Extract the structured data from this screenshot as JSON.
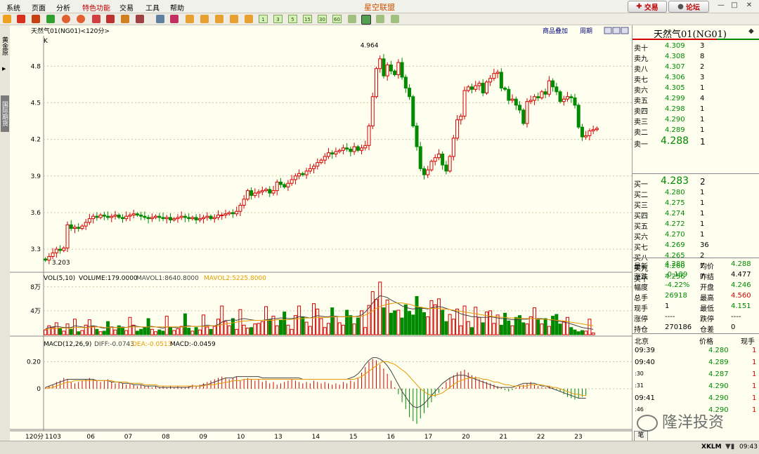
{
  "menu": {
    "items": [
      "系统",
      "页面",
      "分析",
      "特色功能",
      "交易",
      "工具",
      "帮助"
    ],
    "highlight_index": 3
  },
  "app_title": "星空联盟",
  "top_buttons": {
    "trade": "交易",
    "forum": "论坛"
  },
  "toolbar": {
    "period_buttons": [
      "1",
      "3",
      "5",
      "15",
      "30",
      "60"
    ]
  },
  "side_tabs": [
    "黄金原",
    "国际期货"
  ],
  "chart": {
    "header_title": "天然气01(NG01)<120分>",
    "panel_links": [
      "商品叠加",
      "周期"
    ],
    "price_label": "K",
    "high_label": "4.964",
    "low_label": "3.203",
    "price_axis": [
      "4.8",
      "4.5",
      "4.2",
      "3.9",
      "3.6",
      "3.3"
    ],
    "vol_header": {
      "title": "VOL(5,10)",
      "volume": "VOLUME:179.0000",
      "mavol1": "MAVOL1:8640.8000",
      "mavol2": "MAVOL2:5225.8000"
    },
    "vol_axis": [
      "8万",
      "4万"
    ],
    "macd_header": {
      "title": "MACD(12,26,9)",
      "diff": "DIFF:-0.0743",
      "dea": "DEA:-0.0513",
      "macd": "MACD:-0.0459"
    },
    "macd_axis": [
      "0.20",
      "0"
    ],
    "period_label": "120分",
    "x_axis": [
      "1103",
      "06",
      "07",
      "08",
      "09",
      "10",
      "13",
      "14",
      "15",
      "16",
      "17",
      "20",
      "21",
      "22",
      "23"
    ],
    "colors": {
      "up": "#d40000",
      "down": "#008a00",
      "ma1": "#444444",
      "ma2": "#e69a00"
    }
  },
  "chart_data": {
    "type": "candlestick",
    "interval": "120分",
    "ylim": [
      3.18,
      5.02
    ],
    "closes": [
      3.21,
      3.24,
      3.27,
      3.3,
      3.29,
      3.31,
      3.5,
      3.47,
      3.48,
      3.47,
      3.49,
      3.52,
      3.55,
      3.57,
      3.56,
      3.58,
      3.57,
      3.56,
      3.57,
      3.58,
      3.56,
      3.55,
      3.57,
      3.58,
      3.59,
      3.58,
      3.57,
      3.56,
      3.55,
      3.56,
      3.57,
      3.56,
      3.55,
      3.56,
      3.54,
      3.55,
      3.56,
      3.57,
      3.56,
      3.55,
      3.56,
      3.54,
      3.55,
      3.56,
      3.57,
      3.55,
      3.56,
      3.58,
      3.58,
      3.59,
      3.6,
      3.59,
      3.61,
      3.66,
      3.71,
      3.78,
      3.74,
      3.76,
      3.77,
      3.78,
      3.79,
      3.76,
      3.78,
      3.85,
      3.83,
      3.81,
      3.84,
      3.87,
      3.9,
      3.92,
      3.91,
      3.94,
      3.96,
      3.98,
      4.01,
      4.03,
      4.06,
      4.09,
      4.08,
      4.1,
      4.11,
      4.13,
      4.12,
      4.1,
      4.14,
      4.11,
      4.13,
      4.15,
      4.31,
      4.55,
      4.78,
      4.86,
      4.72,
      4.81,
      4.76,
      4.73,
      4.83,
      4.71,
      4.62,
      4.55,
      4.31,
      4.14,
      3.96,
      3.91,
      3.95,
      4.02,
      4.05,
      4.08,
      3.99,
      3.94,
      4.06,
      4.21,
      4.36,
      4.39,
      4.6,
      4.63,
      4.61,
      4.64,
      4.66,
      4.58,
      4.67,
      4.7,
      4.74,
      4.75,
      4.62,
      4.61,
      4.52,
      4.53,
      4.48,
      4.44,
      4.33,
      4.51,
      4.52,
      4.55,
      4.54,
      4.59,
      4.57,
      4.68,
      4.63,
      4.59,
      4.51,
      4.53,
      4.55,
      4.54,
      4.48,
      4.3,
      4.22,
      4.23,
      4.27,
      4.28,
      4.29
    ],
    "volumes": [
      8000,
      15000,
      12000,
      20000,
      10000,
      6000,
      18000,
      9000,
      26000,
      5000,
      7000,
      16000,
      25000,
      14000,
      9000,
      5000,
      6000,
      22000,
      13000,
      8000,
      15000,
      11000,
      7000,
      29000,
      16000,
      6000,
      9000,
      12000,
      27000,
      9000,
      5000,
      8000,
      6000,
      31000,
      12000,
      7000,
      10000,
      14000,
      35000,
      11000,
      6000,
      12000,
      8000,
      33000,
      13000,
      9000,
      14000,
      26000,
      48000,
      22000,
      15000,
      27000,
      9000,
      42000,
      16000,
      11000,
      12000,
      18000,
      19000,
      22000,
      47000,
      25000,
      31000,
      15000,
      24000,
      38000,
      16000,
      9000,
      32000,
      48000,
      30000,
      21000,
      14000,
      52000,
      43000,
      27000,
      12000,
      19000,
      45000,
      30000,
      20000,
      16000,
      41000,
      32000,
      18000,
      28000,
      40000,
      12000,
      49000,
      72000,
      59000,
      88000,
      45000,
      58000,
      36000,
      40000,
      41000,
      28000,
      50000,
      39000,
      33000,
      64000,
      46000,
      37000,
      30000,
      57000,
      50000,
      60000,
      41000,
      22000,
      34000,
      26000,
      43000,
      15000,
      48000,
      22000,
      12000,
      46000,
      29000,
      20000,
      38000,
      40000,
      19000,
      33000,
      16000,
      36000,
      23000,
      15000,
      29000,
      32000,
      20000,
      18000,
      30000,
      45000,
      25000,
      18000,
      27000,
      14000,
      31000,
      34000,
      18000,
      22000,
      29000,
      12000,
      8000,
      5000,
      7000,
      6000,
      26000,
      3000
    ],
    "macd": [
      0.01,
      0.02,
      0.03,
      0.05,
      0.06,
      0.08,
      0.07,
      0.05,
      0.04,
      0.05,
      0.06,
      0.07,
      0.08,
      0.07,
      0.06,
      0.05,
      0.06,
      0.07,
      0.05,
      0.04,
      0.05,
      0.04,
      0.03,
      0.04,
      0.03,
      0.02,
      0.03,
      0.02,
      0.02,
      0.01,
      0.02,
      0.01,
      0.02,
      0.01,
      0.02,
      0.01,
      0.02,
      0.01,
      0.01,
      0.02,
      0.03,
      0.02,
      0.03,
      0.04,
      0.05,
      0.06,
      0.07,
      0.08,
      0.09,
      0.08,
      0.07,
      0.08,
      0.09,
      0.06,
      0.07,
      0.08,
      0.07,
      0.06,
      0.07,
      0.05,
      0.06,
      0.04,
      0.05,
      0.03,
      0.04,
      0.05,
      0.06,
      0.07,
      0.06,
      0.05,
      0.04,
      0.05,
      0.04,
      0.06,
      0.05,
      0.04,
      0.05,
      0.04,
      0.03,
      0.04,
      0.03,
      0.05,
      0.04,
      0.06,
      0.05,
      0.08,
      0.12,
      0.16,
      0.2,
      0.22,
      0.21,
      0.18,
      0.15,
      0.11,
      0.06,
      0.01,
      -0.04,
      -0.1,
      -0.15,
      -0.21,
      -0.24,
      -0.26,
      -0.22,
      -0.18,
      -0.14,
      -0.1,
      -0.06,
      -0.03,
      0.01,
      0.05,
      0.08,
      0.1,
      0.12,
      0.13,
      0.14,
      0.12,
      0.1,
      0.09,
      0.07,
      0.06,
      0.05,
      0.04,
      0.03,
      0.02,
      0.01,
      -0.01,
      -0.02,
      -0.01,
      0.01,
      0.02,
      0.03,
      0.04,
      0.05,
      0.03,
      0.02,
      0.01,
      0.01,
      0.02,
      0.01,
      -0.01,
      -0.02,
      -0.04,
      -0.06,
      -0.07,
      -0.08,
      -0.07,
      -0.06,
      -0.05
    ],
    "diff": [
      0.01,
      0.02,
      0.03,
      0.04,
      0.05,
      0.06,
      0.07,
      0.07,
      0.07,
      0.07,
      0.07,
      0.07,
      0.07,
      0.07,
      0.06,
      0.06,
      0.06,
      0.06,
      0.05,
      0.05,
      0.05,
      0.04,
      0.04,
      0.04,
      0.03,
      0.03,
      0.03,
      0.02,
      0.02,
      0.02,
      0.02,
      0.01,
      0.01,
      0.01,
      0.01,
      0.01,
      0.01,
      0.01,
      0.01,
      0.01,
      0.02,
      0.02,
      0.02,
      0.03,
      0.03,
      0.04,
      0.05,
      0.06,
      0.07,
      0.08,
      0.08,
      0.08,
      0.09,
      0.09,
      0.09,
      0.09,
      0.09,
      0.09,
      0.09,
      0.08,
      0.08,
      0.08,
      0.08,
      0.08,
      0.08,
      0.08,
      0.08,
      0.08,
      0.08,
      0.08,
      0.07,
      0.07,
      0.07,
      0.07,
      0.07,
      0.07,
      0.07,
      0.07,
      0.07,
      0.07,
      0.07,
      0.07,
      0.07,
      0.08,
      0.09,
      0.11,
      0.14,
      0.18,
      0.21,
      0.23,
      0.23,
      0.22,
      0.2,
      0.17,
      0.13,
      0.08,
      0.03,
      -0.02,
      -0.06,
      -0.1,
      -0.13,
      -0.14,
      -0.13,
      -0.11,
      -0.08,
      -0.05,
      -0.02,
      0.01,
      0.04,
      0.06,
      0.08,
      0.09,
      0.1,
      0.1,
      0.1,
      0.09,
      0.08,
      0.07,
      0.06,
      0.05,
      0.04,
      0.03,
      0.02,
      0.01,
      0.01,
      0.01,
      0.01,
      0.01,
      0.02,
      0.03,
      0.04,
      0.04,
      0.04,
      0.04,
      0.03,
      0.02,
      0.02,
      0.01,
      0,
      -0.01,
      -0.02,
      -0.03,
      -0.04,
      -0.05,
      -0.06,
      -0.07,
      -0.07,
      -0.07
    ],
    "dea": [
      0,
      0.01,
      0.01,
      0.02,
      0.03,
      0.04,
      0.05,
      0.05,
      0.06,
      0.06,
      0.06,
      0.06,
      0.06,
      0.06,
      0.06,
      0.06,
      0.06,
      0.06,
      0.06,
      0.05,
      0.05,
      0.05,
      0.05,
      0.04,
      0.04,
      0.04,
      0.04,
      0.03,
      0.03,
      0.03,
      0.03,
      0.02,
      0.02,
      0.02,
      0.02,
      0.02,
      0.02,
      0.02,
      0.02,
      0.02,
      0.02,
      0.02,
      0.02,
      0.02,
      0.03,
      0.03,
      0.03,
      0.04,
      0.04,
      0.05,
      0.05,
      0.06,
      0.06,
      0.06,
      0.07,
      0.07,
      0.07,
      0.07,
      0.07,
      0.07,
      0.07,
      0.07,
      0.07,
      0.07,
      0.07,
      0.07,
      0.07,
      0.07,
      0.07,
      0.07,
      0.07,
      0.07,
      0.07,
      0.07,
      0.07,
      0.07,
      0.07,
      0.07,
      0.07,
      0.07,
      0.07,
      0.07,
      0.07,
      0.07,
      0.07,
      0.08,
      0.09,
      0.11,
      0.13,
      0.15,
      0.17,
      0.19,
      0.2,
      0.2,
      0.19,
      0.18,
      0.16,
      0.14,
      0.12,
      0.09,
      0.06,
      0.03,
      0,
      -0.02,
      -0.04,
      -0.05,
      -0.05,
      -0.04,
      -0.03,
      -0.01,
      0.01,
      0.03,
      0.05,
      0.06,
      0.07,
      0.08,
      0.08,
      0.08,
      0.08,
      0.07,
      0.07,
      0.06,
      0.05,
      0.05,
      0.04,
      0.03,
      0.03,
      0.02,
      0.02,
      0.02,
      0.02,
      0.02,
      0.03,
      0.03,
      0.03,
      0.03,
      0.02,
      0.02,
      0.01,
      0.01,
      0,
      -0.01,
      -0.02,
      -0.03,
      -0.04,
      -0.04,
      -0.05,
      -0.05
    ],
    "mavol1": [
      10000,
      12000,
      13000,
      14000,
      13000,
      12000,
      12000,
      12000,
      15000,
      14000,
      13000,
      12000,
      14000,
      15000,
      14000,
      12000,
      11000,
      12000,
      13000,
      12000,
      12000,
      13000,
      12000,
      14000,
      15000,
      14000,
      13000,
      12000,
      14000,
      14000,
      13000,
      12000,
      11000,
      13000,
      13000,
      12000,
      12000,
      13000,
      15000,
      15000,
      14000,
      14000,
      14000,
      15000,
      16000,
      15000,
      15000,
      17000,
      21000,
      24000,
      24000,
      25000,
      24000,
      26000,
      27000,
      26000,
      25000,
      24000,
      24000,
      24000,
      25000,
      26000,
      27000,
      27000,
      28000,
      28000,
      27000,
      27000,
      28000,
      30000,
      30000,
      29000,
      28000,
      30000,
      32000,
      31000,
      30000,
      30000,
      31000,
      31000,
      30000,
      30000,
      30000,
      30000,
      30000,
      31000,
      33000,
      38000,
      45000,
      53000,
      60000,
      65000,
      64000,
      62000,
      58000,
      55000,
      52000,
      48000,
      46000,
      44000,
      43000,
      44000,
      44000,
      44000,
      43000,
      45000,
      46000,
      47000,
      46000,
      44000,
      42000,
      40000,
      38000,
      35000,
      33000,
      32000,
      30000,
      30000,
      29000,
      29000,
      29000,
      30000,
      29000,
      28000,
      27000,
      27000,
      26000,
      25000,
      25000,
      26000,
      26000,
      26000,
      27000,
      27000,
      27000,
      27000,
      26000,
      25000,
      24000,
      23000,
      22000,
      21000,
      20000,
      18000,
      16000,
      14000,
      12000,
      11000,
      10000,
      9000
    ],
    "mavol2": [
      9000,
      10000,
      10000,
      11000,
      11000,
      11000,
      11000,
      11000,
      12000,
      12000,
      12000,
      12000,
      12000,
      13000,
      13000,
      13000,
      12000,
      12000,
      12000,
      12000,
      12000,
      12000,
      12000,
      13000,
      13000,
      13000,
      13000,
      13000,
      13000,
      13000,
      13000,
      13000,
      13000,
      13000,
      13000,
      13000,
      13000,
      13000,
      13000,
      14000,
      14000,
      14000,
      14000,
      14000,
      14000,
      15000,
      15000,
      15000,
      17000,
      18000,
      19000,
      20000,
      21000,
      22000,
      23000,
      23000,
      24000,
      24000,
      24000,
      24000,
      24000,
      24000,
      24000,
      25000,
      25000,
      25000,
      25000,
      26000,
      26000,
      27000,
      27000,
      28000,
      28000,
      28000,
      29000,
      29000,
      29000,
      29000,
      30000,
      30000,
      30000,
      30000,
      30000,
      30000,
      30000,
      30000,
      31000,
      33000,
      36000,
      40000,
      44000,
      47000,
      49000,
      51000,
      52000,
      53000,
      53000,
      53000,
      52000,
      51000,
      49000,
      47000,
      46000,
      45000,
      44000,
      44000,
      44000,
      44000,
      43000,
      43000,
      42000,
      41000,
      40000,
      39000,
      38000,
      37000,
      36000,
      35000,
      34000,
      33000,
      32000,
      31000,
      30000,
      30000,
      29000,
      29000,
      28000,
      28000,
      28000,
      27000,
      27000,
      27000,
      27000,
      27000,
      26000,
      26000,
      26000,
      25000,
      25000,
      24000,
      24000,
      23000,
      22000,
      21000,
      20000,
      19000,
      18000,
      17000,
      16000,
      15000
    ]
  },
  "quote": {
    "title": "天然气01(NG01)",
    "sells": [
      {
        "label": "卖十",
        "price": "4.309",
        "vol": "3"
      },
      {
        "label": "卖九",
        "price": "4.308",
        "vol": "8"
      },
      {
        "label": "卖八",
        "price": "4.307",
        "vol": "2"
      },
      {
        "label": "卖七",
        "price": "4.306",
        "vol": "3"
      },
      {
        "label": "卖六",
        "price": "4.305",
        "vol": "1"
      },
      {
        "label": "卖五",
        "price": "4.299",
        "vol": "4"
      },
      {
        "label": "卖四",
        "price": "4.298",
        "vol": "1"
      },
      {
        "label": "卖三",
        "price": "4.290",
        "vol": "1"
      },
      {
        "label": "卖二",
        "price": "4.289",
        "vol": "1"
      },
      {
        "label": "卖一",
        "price": "4.288",
        "vol": "1"
      }
    ],
    "buys": [
      {
        "label": "买一",
        "price": "4.283",
        "vol": "2"
      },
      {
        "label": "买二",
        "price": "4.280",
        "vol": "1"
      },
      {
        "label": "买三",
        "price": "4.275",
        "vol": "1"
      },
      {
        "label": "买四",
        "price": "4.274",
        "vol": "1"
      },
      {
        "label": "买五",
        "price": "4.272",
        "vol": "1"
      },
      {
        "label": "买六",
        "price": "4.270",
        "vol": "1"
      },
      {
        "label": "买七",
        "price": "4.269",
        "vol": "36"
      },
      {
        "label": "买八",
        "price": "4.265",
        "vol": "2"
      },
      {
        "label": "买九",
        "price": "4.260",
        "vol": "7"
      },
      {
        "label": "买十",
        "price": "4.256",
        "vol": "7"
      }
    ],
    "stats": [
      {
        "l1": "最新",
        "v1": "4.288",
        "l2": "均价",
        "v2": "4.288"
      },
      {
        "l1": "涨跌",
        "v1": "-0.189",
        "l2": "昨结",
        "v2": "4.477"
      },
      {
        "l1": "幅度",
        "v1": "-4.22%",
        "l2": "开盘",
        "v2": "4.246"
      },
      {
        "l1": "总手",
        "v1": "26918",
        "l2": "最高",
        "v2": "4.560"
      },
      {
        "l1": "现手",
        "v1": "1",
        "l2": "最低",
        "v2": "4.151"
      },
      {
        "l1": "涨停",
        "v1": "----",
        "l2": "跌停",
        "v2": "----"
      },
      {
        "l1": "持仓",
        "v1": "270186",
        "l2": "仓差",
        "v2": "0"
      }
    ],
    "ticks_header": {
      "time": "北京",
      "price": "价格",
      "vol": "现手"
    },
    "ticks": [
      {
        "time": "09:39",
        "price": "4.280",
        "vol": "1"
      },
      {
        "time": "09:40",
        "price": "4.289",
        "vol": "1"
      },
      {
        "time": ":30",
        "price": "4.287",
        "vol": "1"
      },
      {
        "time": ":31",
        "price": "4.290",
        "vol": "1"
      },
      {
        "time": "09:41",
        "price": "4.290",
        "vol": "1"
      },
      {
        "time": ":46",
        "price": "4.290",
        "vol": "1"
      }
    ],
    "bottom_tab": "笔"
  },
  "watermark": "隆洋投资",
  "status": {
    "logo": "XKLM",
    "time": "09:43"
  }
}
